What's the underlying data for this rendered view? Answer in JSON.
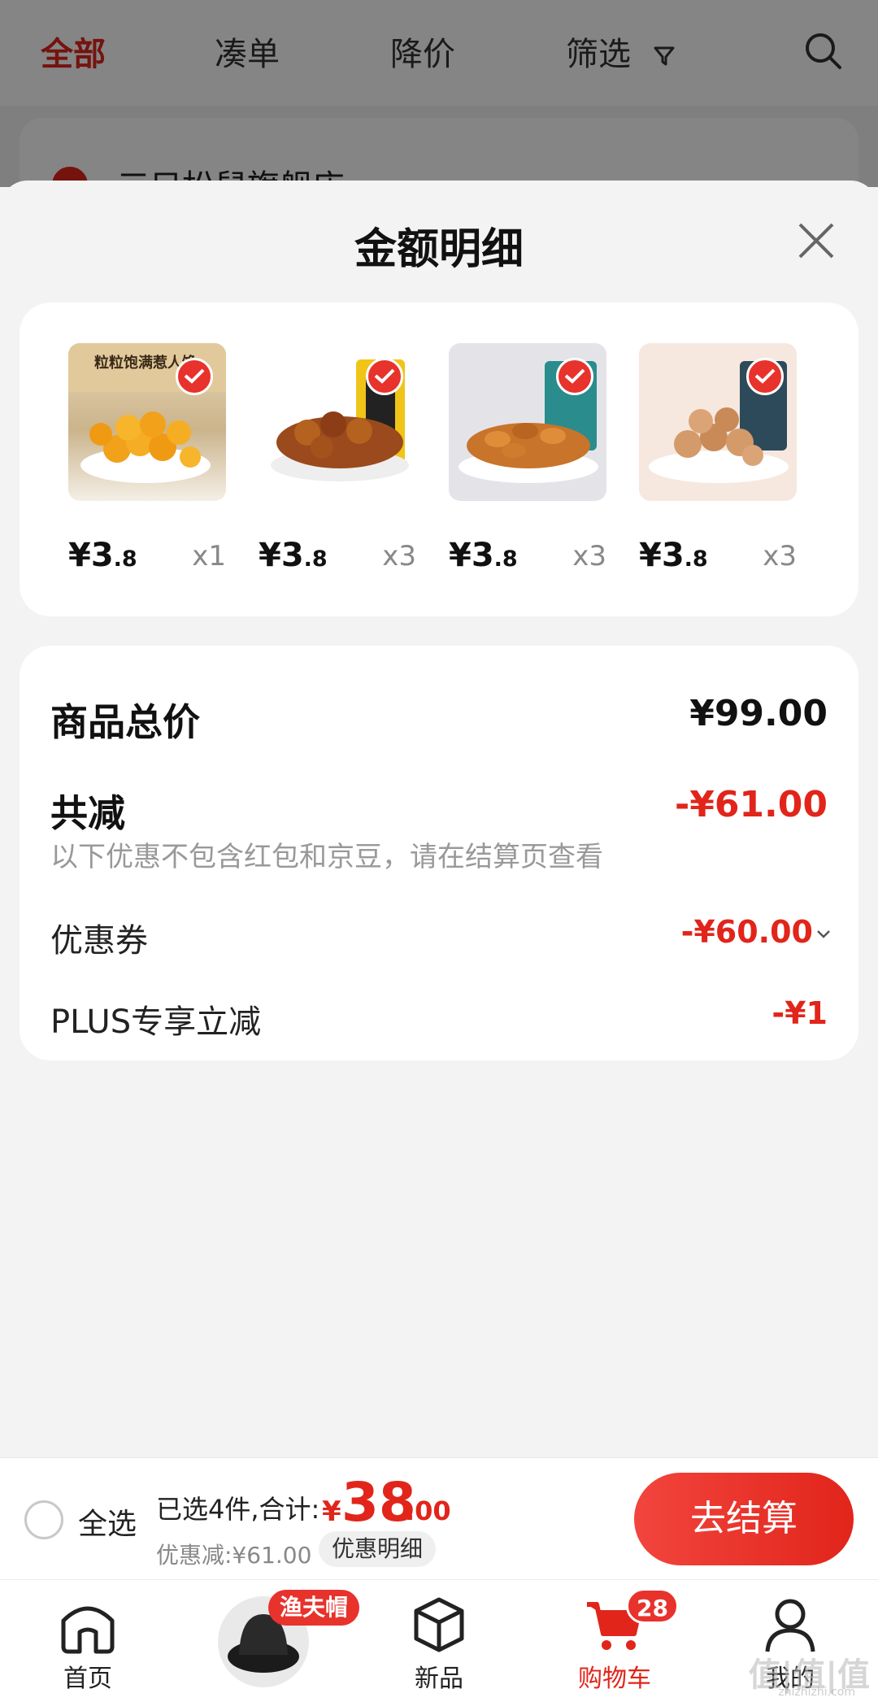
{
  "top_tabs": [
    {
      "label": "全部",
      "active": true
    },
    {
      "label": "凑单",
      "active": false
    },
    {
      "label": "降价",
      "active": false
    },
    {
      "label": "筛选",
      "active": false
    }
  ],
  "store": {
    "name": "三只松鼠旗舰店"
  },
  "sheet": {
    "title": "金额明细",
    "products": [
      {
        "price_int": "¥3",
        "price_dec": ".8",
        "qty": "x1",
        "thumb_text": "粒粒饱满惹人馋"
      },
      {
        "price_int": "¥3",
        "price_dec": ".8",
        "qty": "x3",
        "thumb_text": ""
      },
      {
        "price_int": "¥3",
        "price_dec": ".8",
        "qty": "x3",
        "thumb_text": ""
      },
      {
        "price_int": "¥3",
        "price_dec": ".8",
        "qty": "x3",
        "thumb_text": ""
      }
    ],
    "summary": {
      "goods_total_label": "商品总价",
      "goods_total_value": "¥99.00",
      "reduce_label": "共减",
      "reduce_value": "-¥61.00",
      "note": "以下优惠不包含红包和京豆，请在结算页查看",
      "coupon_label": "优惠券",
      "coupon_value": "-¥60.00",
      "plus_label": "PLUS专享立减",
      "plus_value": "-¥1"
    }
  },
  "checkout": {
    "select_all": "全选",
    "chosen": "已选4件,合计:",
    "total_symbol": "¥",
    "total_int": "38",
    "total_dec": ".00",
    "discount": "优惠减:¥61.00",
    "detail_chip": "优惠明细",
    "button": "去结算"
  },
  "tabbar": {
    "home": "首页",
    "cap_badge": "渔夫帽",
    "new": "新品",
    "cart": "购物车",
    "cart_count": "28",
    "mine": "我的"
  },
  "watermark": {
    "main": "值|值|值",
    "sub": "zhizhizhi.com"
  },
  "colors": {
    "accent": "#e1251b",
    "background": "#f3f3f3"
  }
}
